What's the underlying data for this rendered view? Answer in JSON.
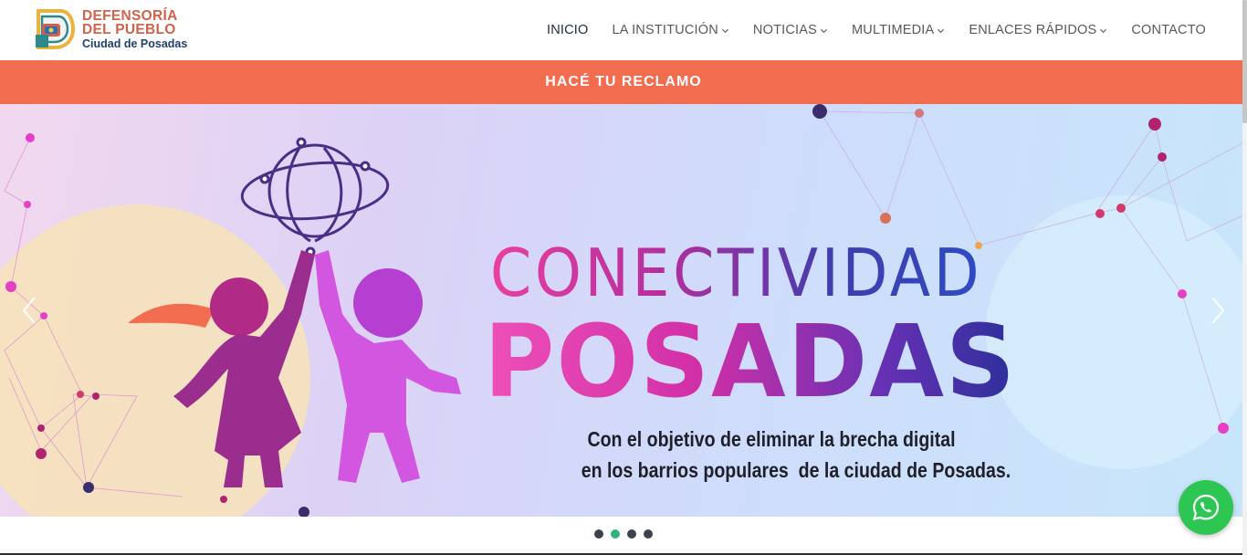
{
  "logo": {
    "line1": "DEFENSORÍA",
    "line2": "DEL PUEBLO",
    "line3": "Ciudad de Posadas",
    "icon": "defensoria-emblem-icon"
  },
  "nav": {
    "items": [
      {
        "label": "INICIO",
        "active": true,
        "dropdown": false
      },
      {
        "label": "LA INSTITUCIÓN",
        "active": false,
        "dropdown": true
      },
      {
        "label": "NOTICIAS",
        "active": false,
        "dropdown": true
      },
      {
        "label": "MULTIMEDIA",
        "active": false,
        "dropdown": true
      },
      {
        "label": "ENLACES RÁPIDOS",
        "active": false,
        "dropdown": true
      },
      {
        "label": "CONTACTO",
        "active": false,
        "dropdown": false
      }
    ]
  },
  "reclamo": {
    "label": "HACÉ TU RECLAMO",
    "color": "#f26d4f"
  },
  "hero": {
    "title_line1": "CONECTIVIDAD",
    "title_line2": "POSADAS",
    "subtitle_line1": "Con el objetivo de eliminar la brecha digital",
    "subtitle_line2": "en los barrios populares  de la ciudad de Posadas.",
    "prev_icon": "chevron-left-icon",
    "next_icon": "chevron-right-icon"
  },
  "carousel": {
    "slides": 4,
    "active_index": 1
  },
  "whatsapp": {
    "icon": "whatsapp-icon",
    "color": "#2ec652"
  },
  "colors": {
    "accent": "#f26d4f",
    "active_dot": "#2fb37c",
    "nav_text": "#55595f"
  }
}
